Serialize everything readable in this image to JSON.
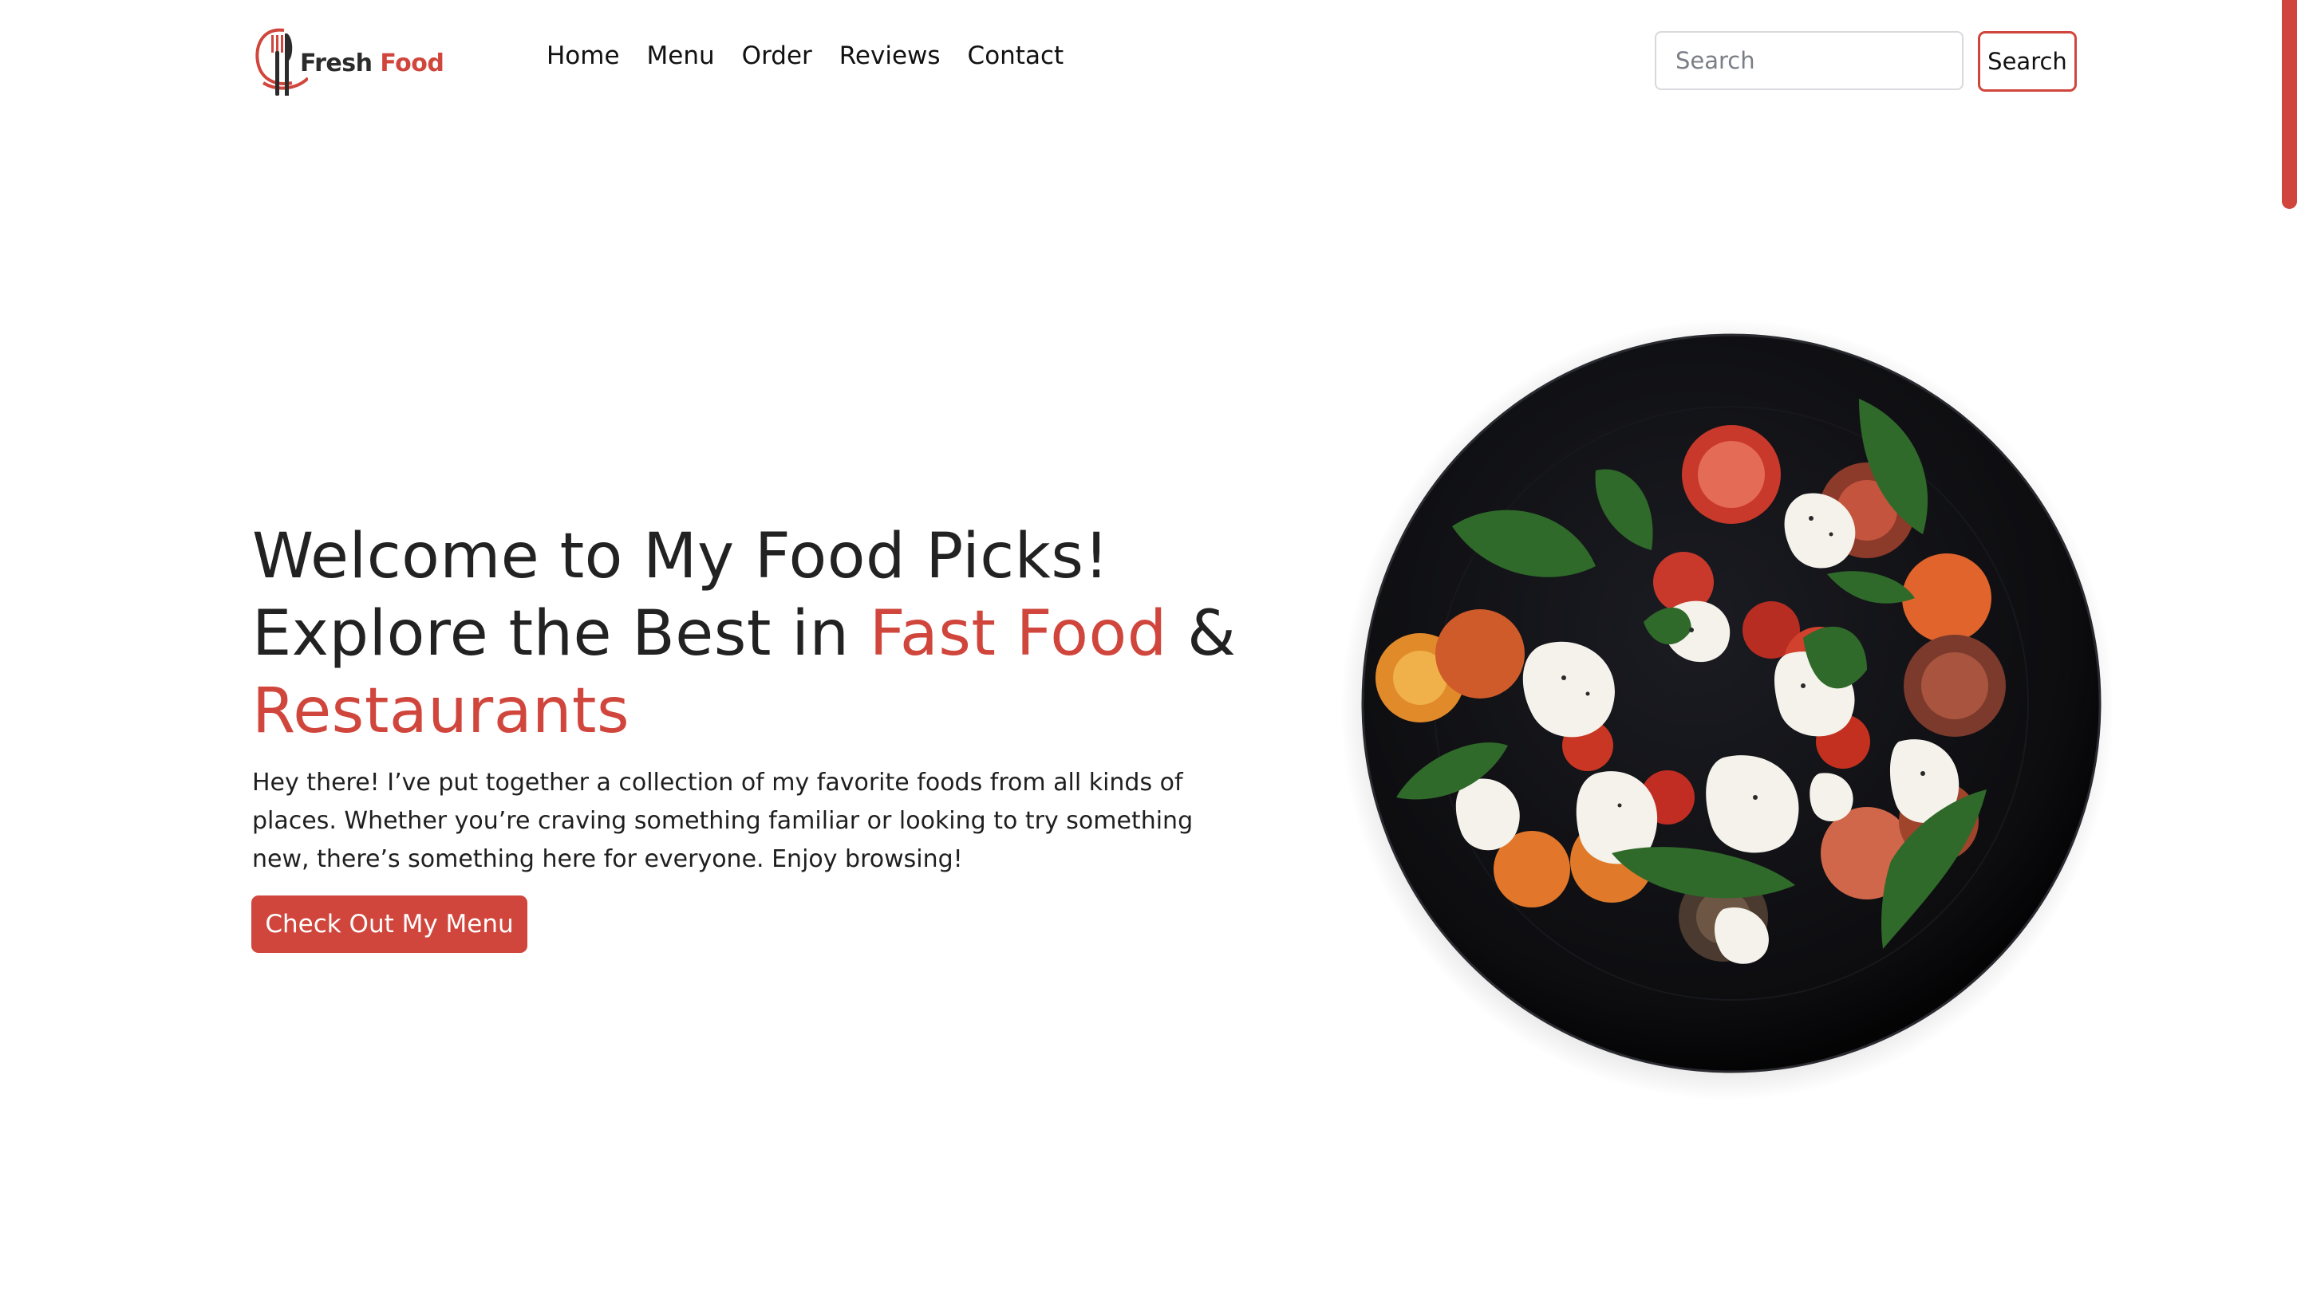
{
  "brand": {
    "word1": "Fresh",
    "word2": "Food",
    "icon": "fork-knife-logo-icon"
  },
  "nav": {
    "items": [
      {
        "label": "Home"
      },
      {
        "label": "Menu"
      },
      {
        "label": "Order"
      },
      {
        "label": "Reviews"
      },
      {
        "label": "Contact"
      }
    ]
  },
  "search": {
    "placeholder": "Search",
    "value": "",
    "button_label": "Search"
  },
  "hero": {
    "title_line1": "Welcome to My Food Picks!",
    "title_line2_prefix": "Explore the Best in",
    "title_accent1": "Fast Food",
    "title_amp": "&",
    "title_accent2": "Restaurants",
    "description": "Hey there! I’ve put together a collection of my favorite foods from all kinds of places. Whether you’re craving something familiar or looking to try something new, there’s something here for everyone. Enjoy browsing!",
    "cta_label": "Check Out My Menu",
    "image_icon": "salad-plate-image"
  },
  "colors": {
    "accent": "#d0463c",
    "text": "#212529",
    "background": "#ffffff"
  }
}
